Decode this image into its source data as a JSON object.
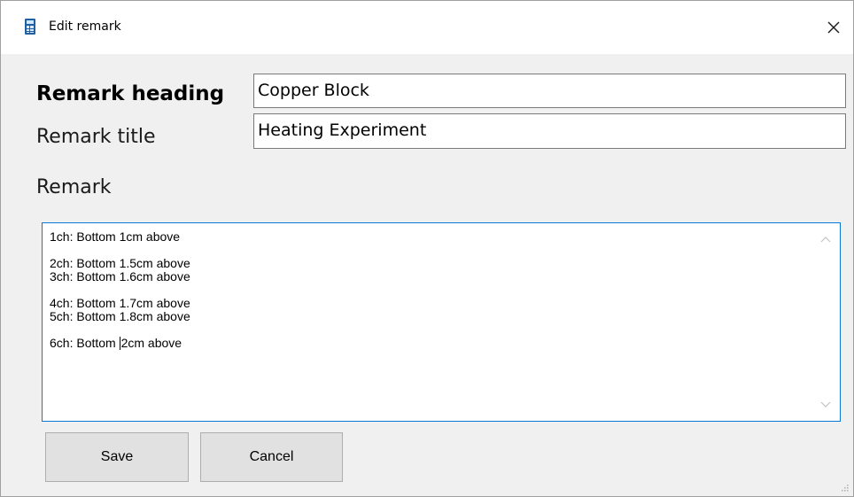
{
  "window": {
    "title": "Edit remark",
    "app_icon": "calculator-icon",
    "close_icon": "close-icon"
  },
  "form": {
    "heading_label": "Remark heading",
    "heading_value": "Copper Block",
    "title_label": "Remark title",
    "title_value": "Heating Experiment",
    "remark_label": "Remark",
    "remark_lines": [
      "1ch: Bottom 1cm above",
      "",
      "2ch: Bottom 1.5cm above",
      "3ch: Bottom 1.6cm above",
      "",
      "4ch: Bottom 1.7cm above",
      "5ch: Bottom 1.8cm above",
      "",
      "6ch: Bottom 2cm above"
    ],
    "remark_caret_line_before": "6ch: Bottom ",
    "remark_caret_line_after": "2cm above"
  },
  "buttons": {
    "save_label": "Save",
    "cancel_label": "Cancel"
  },
  "colors": {
    "focus_border": "#0a78d7",
    "app_icon": "#1f5fa6"
  }
}
